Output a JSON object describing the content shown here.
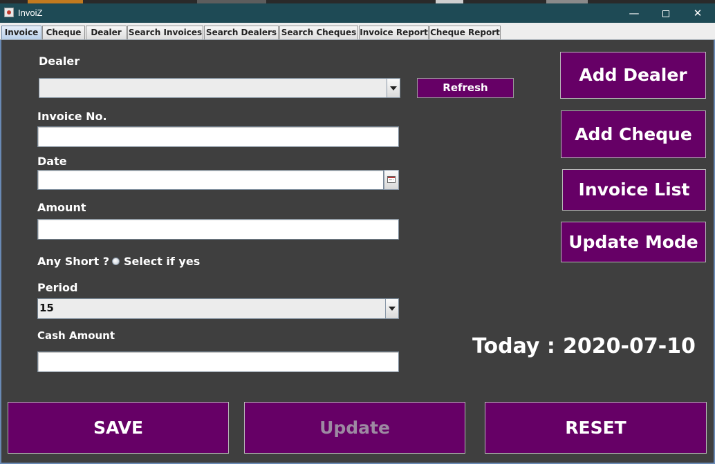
{
  "window": {
    "title": "InvoiZ",
    "minimize_glyph": "—",
    "close_glyph": "✕"
  },
  "tabs": [
    {
      "label": "Invoice",
      "active": true
    },
    {
      "label": "Cheque"
    },
    {
      "label": "Dealer"
    },
    {
      "label": "Search Invoices"
    },
    {
      "label": "Search Dealers"
    },
    {
      "label": "Search Cheques"
    },
    {
      "label": "Invoice Report"
    },
    {
      "label": "Cheque Report"
    }
  ],
  "form": {
    "dealer_label": "Dealer",
    "dealer_value": "",
    "refresh_label": "Refresh",
    "invoice_no_label": "Invoice No.",
    "invoice_no_value": "",
    "date_label": "Date",
    "date_value": "",
    "amount_label": "Amount",
    "amount_value": "",
    "any_short_label": "Any Short ?",
    "any_short_option": "Select if yes",
    "period_label": "Period",
    "period_value": "15",
    "cash_amount_label": "Cash Amount",
    "cash_amount_value": ""
  },
  "side_buttons": {
    "add_dealer": "Add Dealer",
    "add_cheque": "Add Cheque",
    "invoice_list": "Invoice List",
    "update_mode": "Update Mode"
  },
  "today": {
    "label": "Today :",
    "date": "2020-07-10"
  },
  "bottom_buttons": {
    "save": "SAVE",
    "update": "Update",
    "update_enabled": false,
    "reset": "RESET"
  },
  "colors": {
    "accent_purple": "#660066",
    "background": "#3f3f3f",
    "titlebar": "#1e4a55"
  }
}
